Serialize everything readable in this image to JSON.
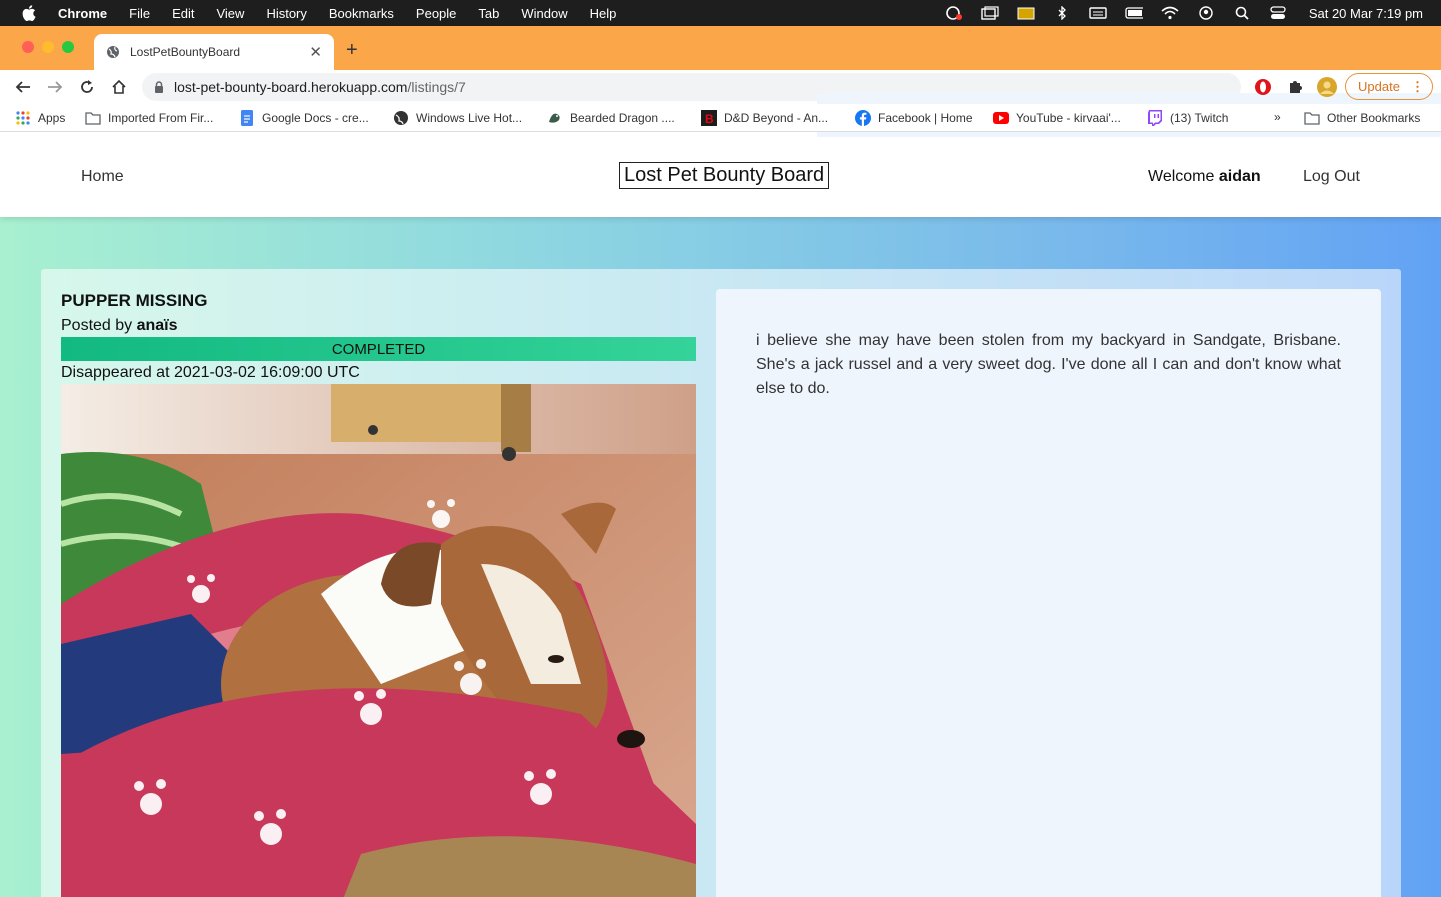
{
  "menubar": {
    "app": "Chrome",
    "menus": [
      "File",
      "Edit",
      "View",
      "History",
      "Bookmarks",
      "People",
      "Tab",
      "Window",
      "Help"
    ],
    "clock": "Sat 20 Mar  7:19 pm"
  },
  "tab": {
    "title": "LostPetBountyBoard"
  },
  "omnibox": {
    "host": "lost-pet-bounty-board.herokuapp.com",
    "path": "/listings/7"
  },
  "update_label": "Update",
  "bookmarks": [
    {
      "label": "Apps",
      "icon": "apps-grid-icon"
    },
    {
      "label": "Imported From Fir...",
      "icon": "folder-icon"
    },
    {
      "label": "Google Docs - cre...",
      "icon": "google-docs-icon"
    },
    {
      "label": "Windows Live Hot...",
      "icon": "globe-icon"
    },
    {
      "label": "Bearded Dragon ....",
      "icon": "dragon-icon"
    },
    {
      "label": "D&D Beyond - An...",
      "icon": "dnd-icon"
    },
    {
      "label": "Facebook | Home",
      "icon": "facebook-icon"
    },
    {
      "label": "YouTube - kirvaai'...",
      "icon": "youtube-icon"
    },
    {
      "label": "(13) Twitch",
      "icon": "twitch-icon"
    }
  ],
  "bookmarks_overflow": "»",
  "other_bookmarks": "Other Bookmarks",
  "site": {
    "home": "Home",
    "brand": "Lost Pet Bounty Board",
    "welcome": "Welcome",
    "username": "aidan",
    "logout": "Log Out"
  },
  "listing": {
    "title": "PUPPER MISSING",
    "posted_by_label": "Posted by",
    "author": "anaïs",
    "status": "COMPLETED",
    "disappeared": "Disappeared at 2021-03-02 16:09:00 UTC",
    "description": "i believe she may have been stolen from my backyard in Sandgate, Brisbane. She's a jack russel and a very sweet dog. I've done all I can and don't know what else to do."
  },
  "colors": {
    "tabstrip": "#fca64a",
    "status_green": "#12b981",
    "gradient_start": "#a8f0d0",
    "gradient_end": "#62a2f4"
  }
}
